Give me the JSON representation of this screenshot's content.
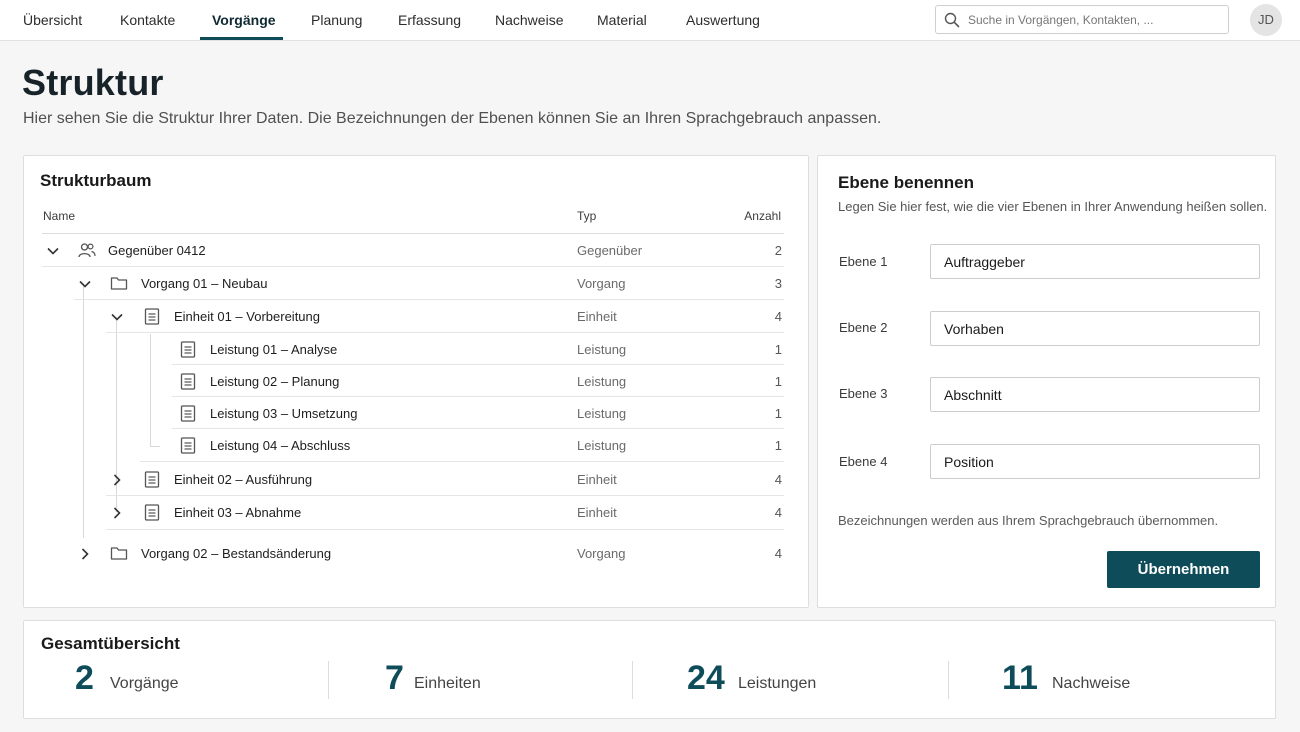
{
  "nav": {
    "items": [
      {
        "label": "Übersicht",
        "active": false
      },
      {
        "label": "Kontakte",
        "active": false
      },
      {
        "label": "Vorgänge",
        "active": true
      },
      {
        "label": "Planung",
        "active": false
      },
      {
        "label": "Erfassung",
        "active": false
      },
      {
        "label": "Nachweise",
        "active": false
      },
      {
        "label": "Material",
        "active": false
      },
      {
        "label": "Auswertung",
        "active": false
      }
    ],
    "search_placeholder": "Suche in Vorgängen, Kontakten, ...",
    "avatar_initials": "JD"
  },
  "page": {
    "title": "Struktur",
    "subtitle": "Hier sehen Sie die Struktur Ihrer Daten. Die Bezeichnungen der Ebenen können Sie an Ihren Sprachgebrauch anpassen."
  },
  "tree": {
    "title": "Strukturbaum",
    "columns": {
      "name": "Name",
      "type": "Typ",
      "count": "Anzahl"
    },
    "rows": [
      {
        "name": "Gegenüber 0412",
        "type": "Gegenüber",
        "count": "2",
        "icon": "people-icon",
        "expanded": true
      },
      {
        "name": "Vorgang 01 – Neubau",
        "type": "Vorgang",
        "count": "3",
        "icon": "folder-icon",
        "expanded": true
      },
      {
        "name": "Einheit 01 – Vorbereitung",
        "type": "Einheit",
        "count": "4",
        "icon": "document-icon",
        "expanded": true
      },
      {
        "name": "Leistung 01 – Analyse",
        "type": "Leistung",
        "count": "1",
        "icon": "document-icon"
      },
      {
        "name": "Leistung 02 – Planung",
        "type": "Leistung",
        "count": "1",
        "icon": "document-icon"
      },
      {
        "name": "Leistung 03 – Umsetzung",
        "type": "Leistung",
        "count": "1",
        "icon": "document-icon"
      },
      {
        "name": "Leistung 04 – Abschluss",
        "type": "Leistung",
        "count": "1",
        "icon": "document-icon"
      },
      {
        "name": "Einheit 02 – Ausführung",
        "type": "Einheit",
        "count": "4",
        "icon": "document-icon",
        "expanded": false
      },
      {
        "name": "Einheit 03 – Abnahme",
        "type": "Einheit",
        "count": "4",
        "icon": "document-icon",
        "expanded": false
      },
      {
        "name": "Vorgang 02 – Bestandsänderung",
        "type": "Vorgang",
        "count": "4",
        "icon": "folder-icon",
        "expanded": false
      }
    ]
  },
  "levels": {
    "title": "Ebene benennen",
    "subtitle": "Legen Sie hier fest, wie die vier Ebenen in Ihrer Anwendung heißen sollen.",
    "fields": [
      {
        "label": "Ebene 1",
        "value": "Auftraggeber"
      },
      {
        "label": "Ebene 2",
        "value": "Vorhaben"
      },
      {
        "label": "Ebene 3",
        "value": "Abschnitt"
      },
      {
        "label": "Ebene 4",
        "value": "Position"
      }
    ],
    "note": "Bezeichnungen werden aus Ihrem Sprachgebrauch übernommen.",
    "apply_label": "Übernehmen"
  },
  "summary": {
    "title": "Gesamtübersicht",
    "stats": [
      {
        "value": "2",
        "label": "Vorgänge"
      },
      {
        "value": "7",
        "label": "Einheiten"
      },
      {
        "value": "24",
        "label": "Leistungen"
      },
      {
        "value": "11",
        "label": "Nachweise"
      }
    ]
  },
  "colors": {
    "accent": "#0f4c5a",
    "background": "#f6f6f6",
    "card": "#ffffff"
  }
}
